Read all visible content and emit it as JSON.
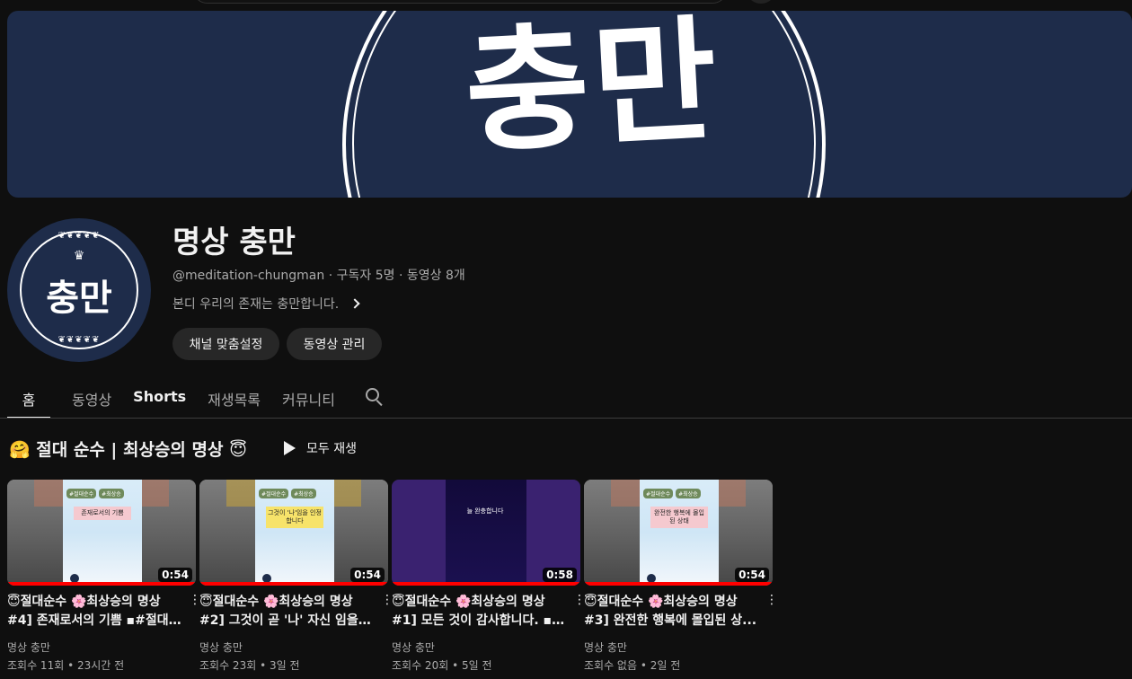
{
  "channel": {
    "banner_text": "충만",
    "avatar_text": "충만",
    "name": "명상 충만",
    "handle": "@meditation-chungman",
    "subscribers": "구독자 5명",
    "video_count": "동영상 8개",
    "meta_separator": "·",
    "description": "본디 우리의 존재는 충만합니다.",
    "customize_button": "채널 맞춤설정",
    "manage_button": "동영상 관리"
  },
  "tabs": [
    {
      "label": "홈",
      "active": true
    },
    {
      "label": "동영상",
      "active": false
    },
    {
      "label": "Shorts",
      "active": false
    },
    {
      "label": "재생목록",
      "active": false
    },
    {
      "label": "커뮤니티",
      "active": false
    }
  ],
  "section": {
    "title": "🤗 절대 순수 | 최상승의 명상 😇",
    "play_all": "모두 재생"
  },
  "videos": [
    {
      "title_line1": "😇절대순수 🌸최상승의 명상",
      "title_line2": "#4] 존재로서의 기쁨 ▪#절대...",
      "duration": "0:54",
      "channel": "명상 충만",
      "views": "조회수 11회",
      "age": "23시간 전",
      "thumb_caption": "존재로서의 기쁨",
      "thumb_tags": [
        "#절대순수",
        "#최상승"
      ]
    },
    {
      "title_line1": "😇절대순수 🌸최상승의 명상",
      "title_line2": "#2] 그것이 곧 '나' 자신 임을 ...",
      "duration": "0:54",
      "channel": "명상 충만",
      "views": "조회수 23회",
      "age": "3일 전",
      "thumb_caption": "그것이 '나'임을 인정합니다",
      "thumb_tags": [
        "#절대순수",
        "#최상승"
      ]
    },
    {
      "title_line1": "😇절대순수 🌸최상승의 명상",
      "title_line2": "#1] 모든 것이 감사합니다. ▪...",
      "duration": "0:58",
      "channel": "명상 충만",
      "views": "조회수 20회",
      "age": "5일 전",
      "thumb_caption": "늘 완충합니다",
      "thumb_tags": []
    },
    {
      "title_line1": "😇절대순수 🌸최상승의 명상",
      "title_line2": "#3] 완전한 행복에 몰입된 상...",
      "duration": "0:54",
      "channel": "명상 충만",
      "views": "조회수 없음",
      "age": "2일 전",
      "thumb_caption": "완전한 행복에 몰입된 상태",
      "thumb_tags": [
        "#절대순수",
        "#최상승"
      ]
    }
  ],
  "stats_separator": "•",
  "icons": {
    "search": "search-icon",
    "chevron": "chevron-right-icon",
    "play": "play-icon",
    "more": "more-vert-icon"
  },
  "colors": {
    "background": "#0f0f0f",
    "banner": "#1e2c4a",
    "progress": "#ff0000",
    "button_bg": "#272727"
  }
}
